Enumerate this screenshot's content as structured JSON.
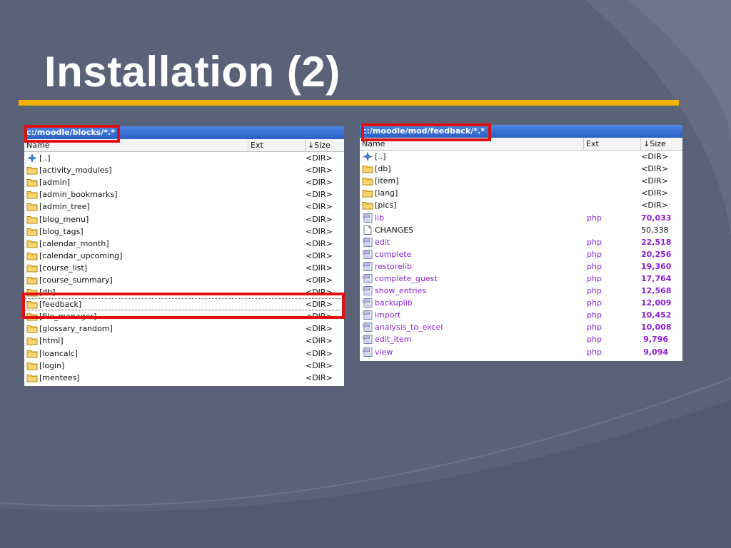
{
  "slide": {
    "title": "Installation (2)",
    "colors": {
      "background": "#5a6278",
      "accent_rule": "#f2b104",
      "title_text": "#ffffff",
      "highlight": "#e01010"
    }
  },
  "left_panel": {
    "path": "c:/moodle/blocks/*.*",
    "columns": {
      "name": "Name",
      "ext": "Ext",
      "size": "↓Size"
    },
    "rows": [
      {
        "icon": "parent-dir-icon",
        "name": "[..]",
        "ext": "",
        "size": "<DIR>"
      },
      {
        "icon": "folder-icon",
        "name": "[activity_modules]",
        "ext": "",
        "size": "<DIR>"
      },
      {
        "icon": "folder-icon",
        "name": "[admin]",
        "ext": "",
        "size": "<DIR>"
      },
      {
        "icon": "folder-icon",
        "name": "[admin_bookmarks]",
        "ext": "",
        "size": "<DIR>"
      },
      {
        "icon": "folder-icon",
        "name": "[admin_tree]",
        "ext": "",
        "size": "<DIR>"
      },
      {
        "icon": "folder-icon",
        "name": "[blog_menu]",
        "ext": "",
        "size": "<DIR>"
      },
      {
        "icon": "folder-icon",
        "name": "[blog_tags]",
        "ext": "",
        "size": "<DIR>"
      },
      {
        "icon": "folder-icon",
        "name": "[calendar_month]",
        "ext": "",
        "size": "<DIR>"
      },
      {
        "icon": "folder-icon",
        "name": "[calendar_upcoming]",
        "ext": "",
        "size": "<DIR>"
      },
      {
        "icon": "folder-icon",
        "name": "[course_list]",
        "ext": "",
        "size": "<DIR>"
      },
      {
        "icon": "folder-icon",
        "name": "[course_summary]",
        "ext": "",
        "size": "<DIR>"
      },
      {
        "icon": "folder-icon",
        "name": "[db]",
        "ext": "",
        "size": "<DIR>"
      },
      {
        "icon": "folder-icon",
        "name": "[feedback]",
        "ext": "",
        "size": "<DIR>"
      },
      {
        "icon": "folder-icon",
        "name": "[file_manager]",
        "ext": "",
        "size": "<DIR>"
      },
      {
        "icon": "folder-icon",
        "name": "[glossary_random]",
        "ext": "",
        "size": "<DIR>"
      },
      {
        "icon": "folder-icon",
        "name": "[html]",
        "ext": "",
        "size": "<DIR>"
      },
      {
        "icon": "folder-icon",
        "name": "[loancalc]",
        "ext": "",
        "size": "<DIR>"
      },
      {
        "icon": "folder-icon",
        "name": "[login]",
        "ext": "",
        "size": "<DIR>"
      },
      {
        "icon": "folder-icon",
        "name": "[mentees]",
        "ext": "",
        "size": "<DIR>"
      }
    ]
  },
  "right_panel": {
    "path": "c:/moodle/mod/feedback/*.*",
    "columns": {
      "name": "Name",
      "ext": "Ext",
      "size": "↓Size"
    },
    "rows": [
      {
        "icon": "parent-dir-icon",
        "name": "[..]",
        "ext": "",
        "size": "<DIR>"
      },
      {
        "icon": "folder-icon",
        "name": "[db]",
        "ext": "",
        "size": "<DIR>"
      },
      {
        "icon": "folder-icon",
        "name": "[item]",
        "ext": "",
        "size": "<DIR>"
      },
      {
        "icon": "folder-icon",
        "name": "[lang]",
        "ext": "",
        "size": "<DIR>"
      },
      {
        "icon": "folder-icon",
        "name": "[pics]",
        "ext": "",
        "size": "<DIR>"
      },
      {
        "icon": "php-file-icon",
        "name": "lib",
        "ext": "php",
        "size": "70,033"
      },
      {
        "icon": "text-file-icon",
        "name": "CHANGES",
        "ext": "",
        "size": "50,338"
      },
      {
        "icon": "php-file-icon",
        "name": "edit",
        "ext": "php",
        "size": "22,518"
      },
      {
        "icon": "php-file-icon",
        "name": "complete",
        "ext": "php",
        "size": "20,256"
      },
      {
        "icon": "php-file-icon",
        "name": "restorelib",
        "ext": "php",
        "size": "19,360"
      },
      {
        "icon": "php-file-icon",
        "name": "complete_guest",
        "ext": "php",
        "size": "17,764"
      },
      {
        "icon": "php-file-icon",
        "name": "show_entries",
        "ext": "php",
        "size": "12,568"
      },
      {
        "icon": "php-file-icon",
        "name": "backuplib",
        "ext": "php",
        "size": "12,009"
      },
      {
        "icon": "php-file-icon",
        "name": "import",
        "ext": "php",
        "size": "10,452"
      },
      {
        "icon": "php-file-icon",
        "name": "analysis_to_excel",
        "ext": "php",
        "size": "10,008"
      },
      {
        "icon": "php-file-icon",
        "name": "edit_item",
        "ext": "php",
        "size": "9,796"
      },
      {
        "icon": "php-file-icon",
        "name": "view",
        "ext": "php",
        "size": "9,094"
      }
    ]
  }
}
